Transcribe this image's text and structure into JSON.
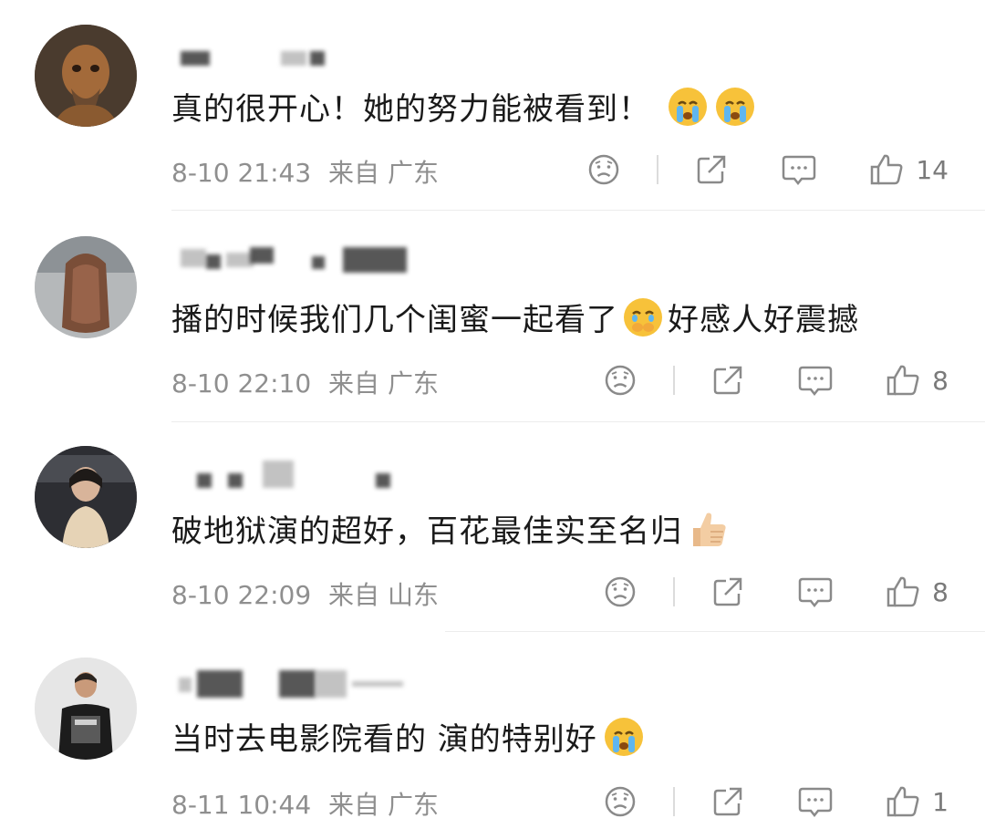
{
  "comments": [
    {
      "text": "真的很开心！她的努力能被看到！",
      "time": "8-10 21:43",
      "from": "来自",
      "region": "广东",
      "likes": "14",
      "emojis": [
        "crying-face",
        "crying-face"
      ]
    },
    {
      "text": "播的时候我们几个闺蜜一起看了",
      "text_after_emoji": "好感人好震撼",
      "time": "8-10 22:10",
      "from": "来自",
      "region": "广东",
      "likes": "8",
      "emojis": [
        "moved-face"
      ]
    },
    {
      "text": "破地狱演的超好，百花最佳实至名归",
      "time": "8-10 22:09",
      "from": "来自",
      "region": "山东",
      "likes": "8",
      "emojis": [
        "thumbs-up"
      ]
    },
    {
      "text": "当时去电影院看的 演的特别好",
      "time": "8-11 10:44",
      "from": "来自",
      "region": "广东",
      "likes": "1",
      "emojis": [
        "crying-face"
      ]
    }
  ],
  "icons": {
    "dislike": "sad-face-icon",
    "share": "share-icon",
    "reply": "comment-icon",
    "like": "thumbs-up-icon"
  },
  "colors": {
    "text": "#1a1a1a",
    "meta": "#8f8f8f",
    "icon": "#8a8a8a"
  }
}
